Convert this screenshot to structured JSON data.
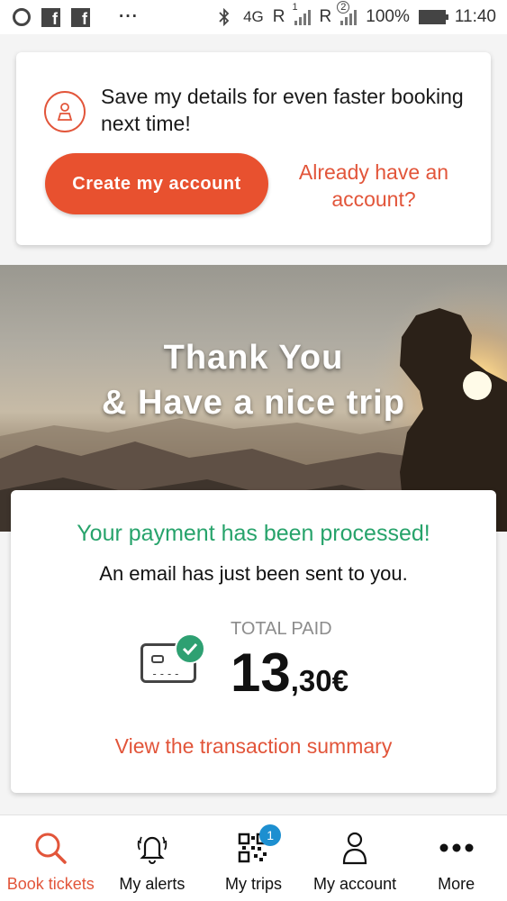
{
  "status_bar": {
    "network": "4G",
    "roaming_1": "R",
    "roaming_2": "R",
    "sim_1": "1",
    "sim_2": "2",
    "battery": "100%",
    "time": "11:40",
    "more": "···"
  },
  "account_prompt": {
    "message": "Save my details for even faster booking next time!",
    "create_label": "Create my account",
    "login_label": "Already have an account?"
  },
  "hero": {
    "line1": "Thank You",
    "line2": "& Have a nice trip"
  },
  "payment": {
    "title": "Your payment has been processed!",
    "subtitle": "An email has just been sent to you.",
    "total_label": "TOTAL PAID",
    "amount_int": "13",
    "amount_dec": ",30€",
    "summary_link": "View the transaction summary"
  },
  "nav": {
    "items": [
      {
        "label": "Book tickets",
        "icon": "search-icon"
      },
      {
        "label": "My alerts",
        "icon": "bell-icon"
      },
      {
        "label": "My trips",
        "icon": "qr-code-icon",
        "badge": "1"
      },
      {
        "label": "My account",
        "icon": "user-icon"
      },
      {
        "label": "More",
        "icon": "more-dots-icon"
      }
    ]
  },
  "colors": {
    "accent": "#e8512f",
    "success": "#27a36b",
    "badge": "#1d8fd0"
  }
}
